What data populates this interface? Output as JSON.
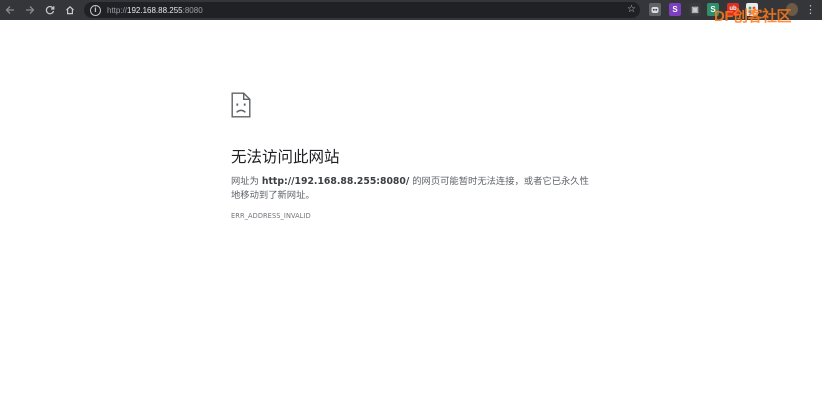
{
  "browser": {
    "url_prefix": "http://",
    "url_host": "192.168.88.255",
    "url_port": ":8080",
    "extension_labels": [
      "S",
      "S",
      "ub"
    ],
    "watermark": "DF创客社区"
  },
  "error_page": {
    "title": "无法访问此网站",
    "desc_before": "网址为 ",
    "desc_url": "http://192.168.88.255:8080/",
    "desc_after": " 的网页可能暂时无法连接，或者它已永久性地移动到了新网址。",
    "error_code": "ERR_ADDRESS_INVALID"
  },
  "colors": {
    "toolbar_bg": "#35363a",
    "omnibox_bg": "#202124",
    "title_text": "#202124",
    "body_text": "#5f6368"
  }
}
